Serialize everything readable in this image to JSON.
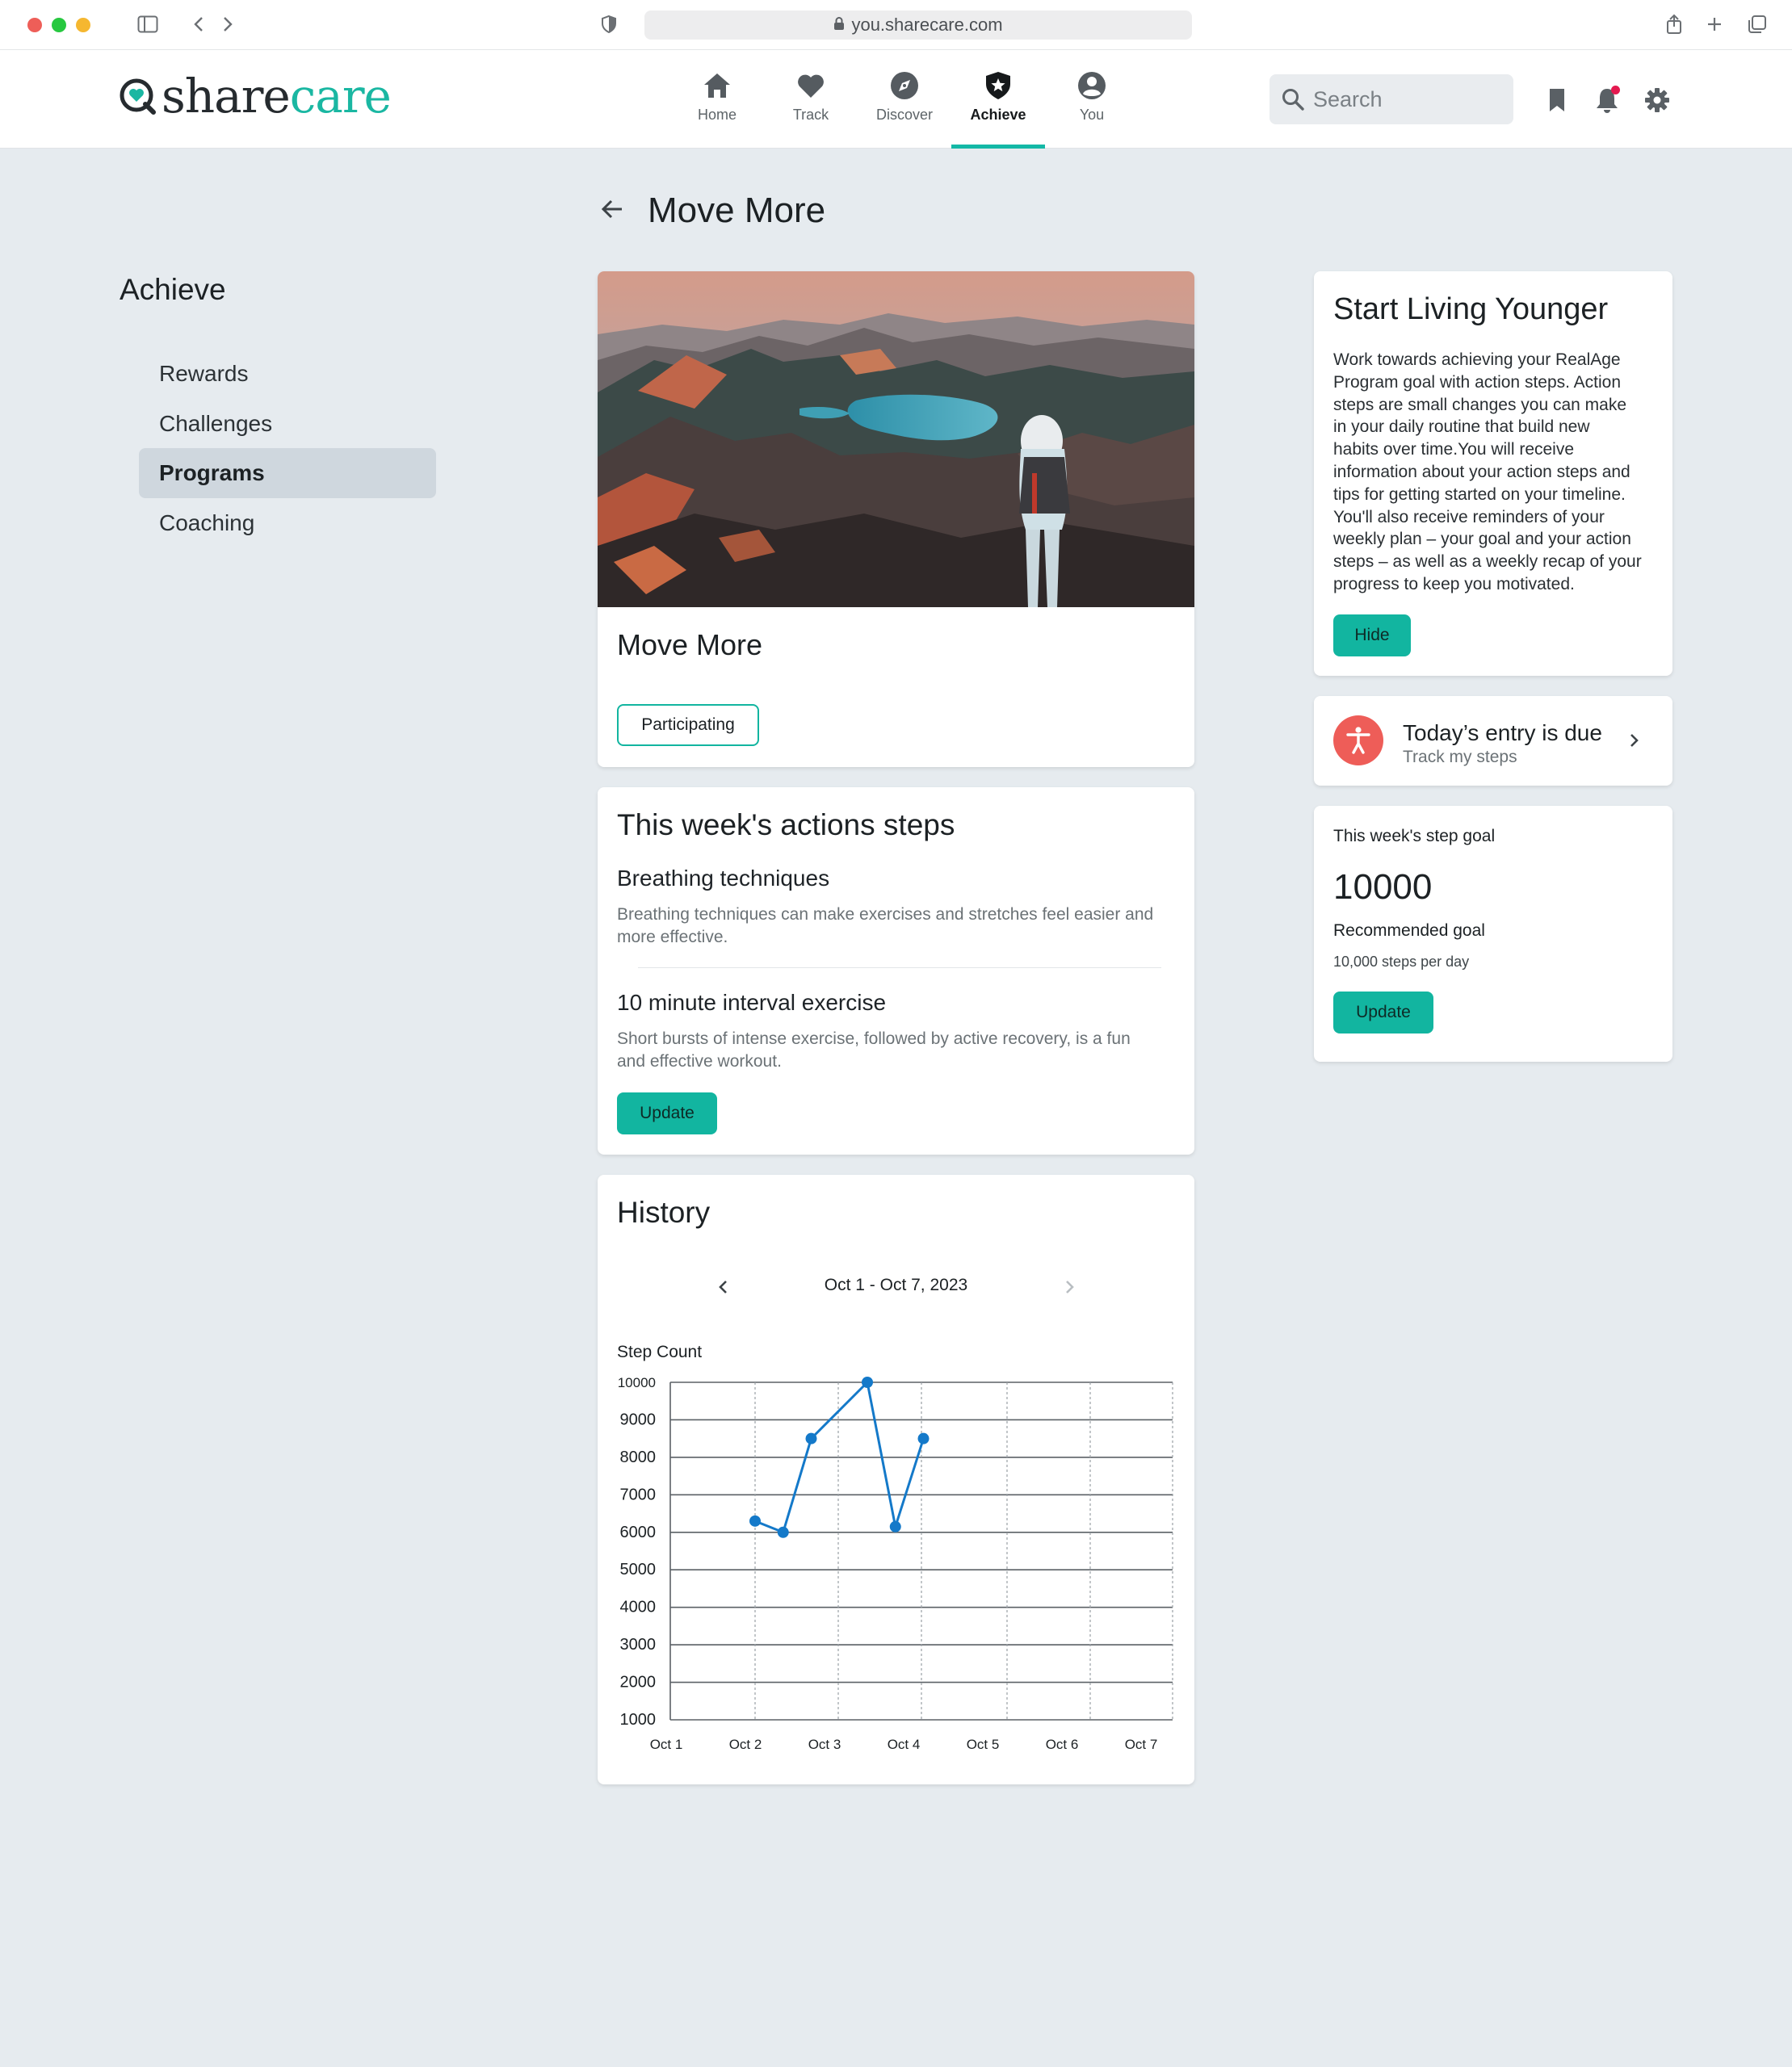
{
  "browser": {
    "url": "you.sharecare.com"
  },
  "header": {
    "logo_share": "share",
    "logo_care": "care",
    "nav": [
      {
        "label": "Home",
        "icon": "home-icon"
      },
      {
        "label": "Track",
        "icon": "heart-icon"
      },
      {
        "label": "Discover",
        "icon": "compass-icon"
      },
      {
        "label": "Achieve",
        "icon": "shield-star-icon",
        "active": true
      },
      {
        "label": "You",
        "icon": "user-circle-icon"
      }
    ],
    "search_placeholder": "Search"
  },
  "sidebar": {
    "title": "Achieve",
    "items": [
      {
        "label": "Rewards"
      },
      {
        "label": "Challenges"
      },
      {
        "label": "Programs",
        "active": true
      },
      {
        "label": "Coaching"
      }
    ]
  },
  "page": {
    "title": "Move More"
  },
  "program_card": {
    "title": "Move More",
    "status_label": "Participating"
  },
  "actions_card": {
    "title": "This week's actions steps",
    "steps": [
      {
        "title": "Breathing techniques",
        "desc_line1": "Breathing techniques can make exercises and stretches feel easier and",
        "desc_line2": "more effective."
      },
      {
        "title": "10 minute interval exercise",
        "desc_line1": "Short bursts of intense exercise, followed by active recovery, is a fun",
        "desc_line2": "and effective workout."
      }
    ],
    "update_label": "Update"
  },
  "history_card": {
    "title": "History",
    "date_range": "Oct 1 - Oct 7, 2023"
  },
  "chart_data": {
    "type": "line",
    "title": "",
    "ylabel": "Step Count",
    "xlabel": "",
    "categories": [
      "Oct 1",
      "Oct 2",
      "Oct 3",
      "Oct 4",
      "Oct 5",
      "Oct 6",
      "Oct 7"
    ],
    "y_ticks": [
      10000,
      9000,
      8000,
      7000,
      6000,
      5000,
      4000,
      3000,
      2000,
      1000
    ],
    "ylim": [
      1000,
      10000
    ],
    "grid": true,
    "series": [
      {
        "color": "#1479c9",
        "points": [
          {
            "x": "Oct 2",
            "y": 6300
          },
          {
            "x": "Oct 2.5",
            "y": 6000
          },
          {
            "x": "Oct 3",
            "y": 8500
          },
          {
            "x": "Oct 4",
            "y": 10000
          },
          {
            "x": "Oct 4.5",
            "y": 6150
          },
          {
            "x": "Oct 5",
            "y": 8500
          }
        ]
      }
    ]
  },
  "intro_card": {
    "title": "Start Living Younger",
    "body_lines": [
      "Work towards achieving your RealAge",
      "Program goal with action steps. Action",
      "steps are small changes you can make",
      "in your daily routine that build new",
      "habits over time.You will receive",
      "information about your action steps and",
      "tips for getting started on your timeline.",
      "You'll also receive reminders of your",
      "weekly plan – your goal and your action",
      "steps – as well as a weekly recap of your",
      "progress to keep you motivated."
    ],
    "hide_label": "Hide"
  },
  "entry_card": {
    "title": "Today’s entry is due",
    "subtitle": "Track my steps"
  },
  "goal_card": {
    "label": "This week's step goal",
    "value": "10000",
    "recommended_label": "Recommended goal",
    "recommended_detail": "10,000 steps per day",
    "update_label": "Update"
  },
  "colors": {
    "accent": "#12b5a0",
    "brand_teal": "#1ab7a2",
    "chart_line": "#1479c9",
    "entry_icon": "#ee5d58",
    "notification": "#e4194f"
  }
}
